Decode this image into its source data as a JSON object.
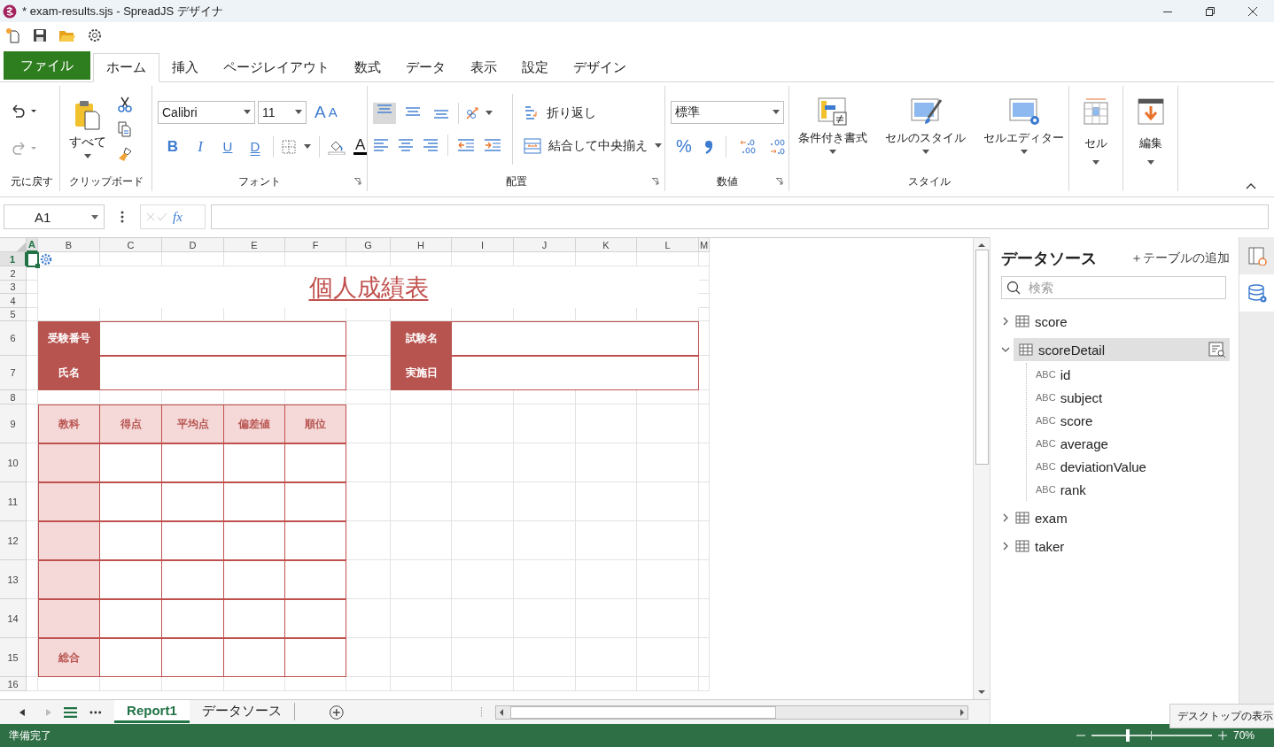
{
  "window": {
    "title": "* exam-results.sjs - SpreadJS デザイナ"
  },
  "menu_tabs": [
    {
      "label": "ファイル",
      "kind": "file",
      "selected": false
    },
    {
      "label": "ホーム",
      "kind": "tab",
      "selected": true
    },
    {
      "label": "挿入",
      "kind": "tab",
      "selected": false
    },
    {
      "label": "ページレイアウト",
      "kind": "tab",
      "selected": false
    },
    {
      "label": "数式",
      "kind": "tab",
      "selected": false
    },
    {
      "label": "データ",
      "kind": "tab",
      "selected": false
    },
    {
      "label": "表示",
      "kind": "tab",
      "selected": false
    },
    {
      "label": "設定",
      "kind": "tab",
      "selected": false
    },
    {
      "label": "デザイン",
      "kind": "tab",
      "selected": false
    }
  ],
  "ribbon": {
    "undo": {
      "label": "元に戻す",
      "undo_disabled": false,
      "redo_disabled": true
    },
    "clipboard": {
      "label": "クリップボード",
      "paste": "すべて"
    },
    "font": {
      "label": "フォント",
      "family": "Calibri",
      "size": "11",
      "grow": "A",
      "shrink": "A",
      "bold": "B",
      "italic": "I",
      "underline": "U",
      "double_underline": "D",
      "font_color": "A"
    },
    "alignment": {
      "label": "配置",
      "vertical": [
        {
          "selected": true
        },
        {
          "selected": false
        },
        {
          "selected": false
        }
      ],
      "wrap": "折り返し",
      "merge": "結合して中央揃え"
    },
    "number": {
      "label": "数値",
      "format": "標準",
      "percent": "%"
    },
    "style": {
      "label": "スタイル",
      "buttons": [
        "条件付き書式",
        "セルのスタイル",
        "セルエディター"
      ]
    },
    "cells": {
      "button": "セル"
    },
    "editing": {
      "button": "編集"
    }
  },
  "formula_bar": {
    "name_box": "A1",
    "fx": "fx"
  },
  "sheet": {
    "columns": [
      {
        "label": "A",
        "selected": true
      },
      {
        "label": "B",
        "selected": false
      },
      {
        "label": "C",
        "selected": false
      },
      {
        "label": "D",
        "selected": false
      },
      {
        "label": "E",
        "selected": false
      },
      {
        "label": "F",
        "selected": false
      },
      {
        "label": "G",
        "selected": false
      },
      {
        "label": "H",
        "selected": false
      },
      {
        "label": "I",
        "selected": false
      },
      {
        "label": "J",
        "selected": false
      },
      {
        "label": "K",
        "selected": false
      },
      {
        "label": "L",
        "selected": false
      },
      {
        "label": "M",
        "selected": false
      }
    ],
    "rows": [
      {
        "label": "1",
        "selected": true
      },
      {
        "label": "2",
        "selected": false
      },
      {
        "label": "3",
        "selected": false
      },
      {
        "label": "4",
        "selected": false
      },
      {
        "label": "5",
        "selected": false
      },
      {
        "label": "6",
        "selected": false
      },
      {
        "label": "7",
        "selected": false
      },
      {
        "label": "8",
        "selected": false
      },
      {
        "label": "9",
        "selected": false
      },
      {
        "label": "10",
        "selected": false
      },
      {
        "label": "11",
        "selected": false
      },
      {
        "label": "12",
        "selected": false
      },
      {
        "label": "13",
        "selected": false
      },
      {
        "label": "14",
        "selected": false
      },
      {
        "label": "15",
        "selected": false
      },
      {
        "label": "16",
        "selected": false
      }
    ],
    "title": "個人成績表",
    "info": [
      {
        "label": "受験番号"
      },
      {
        "label": "氏名"
      },
      {
        "label": "試験名"
      },
      {
        "label": "実施日"
      }
    ],
    "score_table": {
      "headers": [
        "教科",
        "得点",
        "平均点",
        "偏差値",
        "順位"
      ],
      "rows": [
        {
          "kind": "subject"
        },
        {
          "kind": "subject"
        },
        {
          "kind": "subject"
        },
        {
          "kind": "subject"
        },
        {
          "kind": "subject"
        },
        {
          "kind": "total",
          "label": "総合"
        }
      ]
    }
  },
  "sheet_tabs": [
    {
      "label": "Report1",
      "selected": true
    },
    {
      "label": "データソース",
      "selected": false
    }
  ],
  "data_source": {
    "title": "データソース",
    "add_table": "＋テーブルの追加",
    "search": {
      "placeholder": "検索"
    },
    "tables": [
      {
        "name": "score",
        "expanded": false,
        "selected": false
      },
      {
        "name": "scoreDetail",
        "expanded": true,
        "selected": true,
        "children": [
          {
            "type": "ABC",
            "name": "id"
          },
          {
            "type": "ABC",
            "name": "subject"
          },
          {
            "type": "ABC",
            "name": "score"
          },
          {
            "type": "ABC",
            "name": "average"
          },
          {
            "type": "ABC",
            "name": "deviationValue"
          },
          {
            "type": "ABC",
            "name": "rank"
          }
        ]
      },
      {
        "name": "exam",
        "expanded": false,
        "selected": false
      },
      {
        "name": "taker",
        "expanded": false,
        "selected": false
      }
    ]
  },
  "side_tabs": [
    {
      "selected": false
    },
    {
      "selected": true
    }
  ],
  "status_bar": {
    "text": "準備完了",
    "zoom": {
      "level": 0.29,
      "reading": "70%"
    }
  },
  "tooltip": {
    "text": "デスクトップの表示"
  }
}
